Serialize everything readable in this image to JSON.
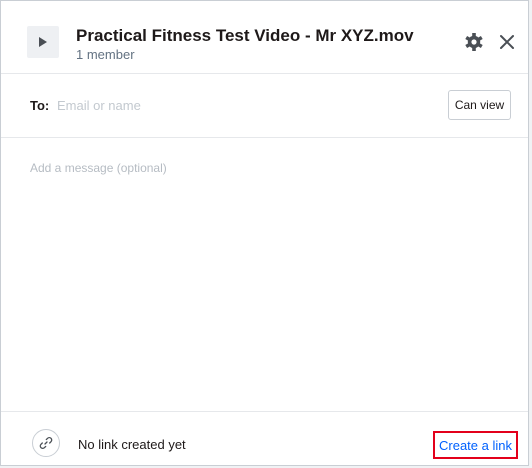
{
  "header": {
    "file_name": "Practical Fitness Test Video - Mr XYZ.mov",
    "member_count": "1 member",
    "icons": {
      "file": "play-icon",
      "settings": "gear-icon",
      "close": "close-icon"
    }
  },
  "recipients": {
    "label": "To:",
    "placeholder": "Email or name",
    "value": "",
    "permission": "Can view"
  },
  "message": {
    "placeholder": "Add a message (optional)",
    "value": ""
  },
  "footer": {
    "link_icon": "link-icon",
    "status": "No link created yet",
    "create_link_label": "Create a link"
  },
  "colors": {
    "accent_link": "#0061fe",
    "highlight_outline": "#e3001b"
  }
}
